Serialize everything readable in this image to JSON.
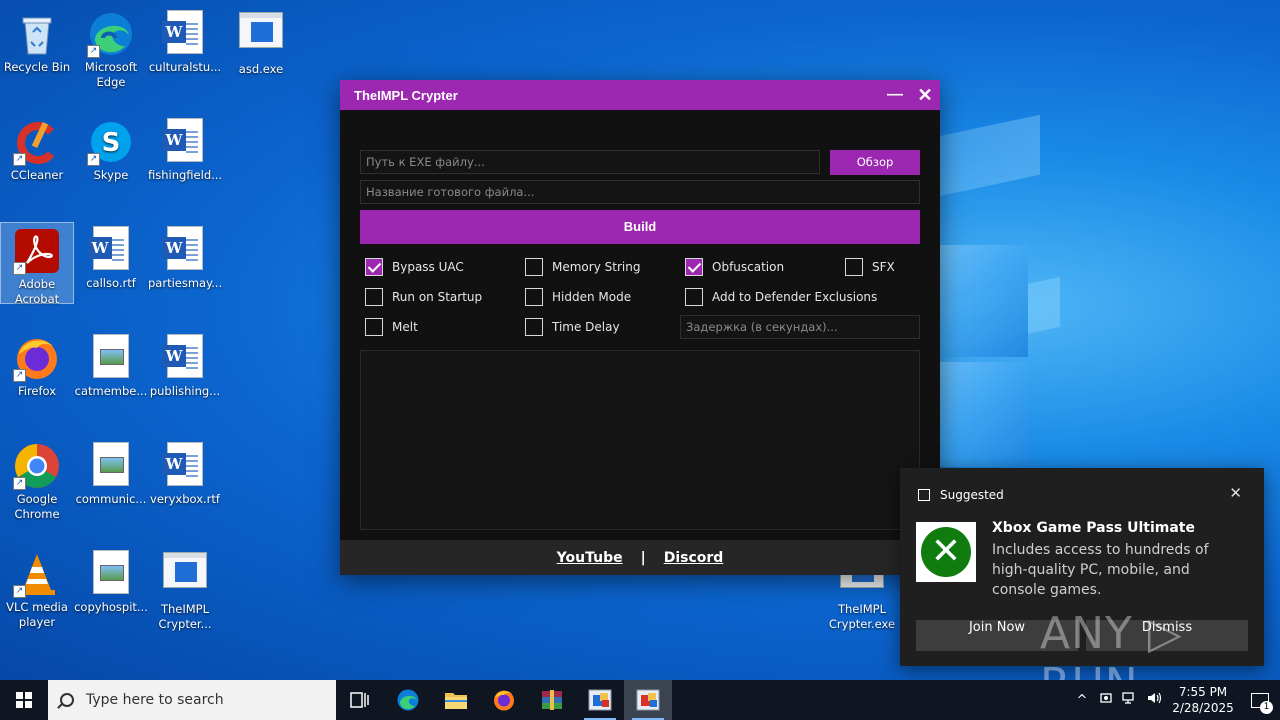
{
  "desktop": {
    "icons": [
      {
        "label": "Recycle Bin"
      },
      {
        "label": "Microsoft Edge"
      },
      {
        "label": "culturalstu..."
      },
      {
        "label": "asd.exe"
      },
      {
        "label": "CCleaner"
      },
      {
        "label": "Skype"
      },
      {
        "label": "fishingfield..."
      },
      {
        "label": "Adobe Acrobat"
      },
      {
        "label": "callso.rtf"
      },
      {
        "label": "partiesmay..."
      },
      {
        "label": "Firefox"
      },
      {
        "label": "catmembe..."
      },
      {
        "label": "publishing..."
      },
      {
        "label": "Google Chrome"
      },
      {
        "label": "communic..."
      },
      {
        "label": "veryxbox.rtf"
      },
      {
        "label": "VLC media player"
      },
      {
        "label": "copyhospit..."
      },
      {
        "label": "TheIMPL Crypter..."
      },
      {
        "label": "TheIMPL Crypter.exe"
      }
    ]
  },
  "app": {
    "title": "TheIMPL Crypter",
    "minimize_glyph": "—",
    "close_glyph": "✕",
    "exe_path_placeholder": "Путь к EXE файлу...",
    "browse_label": "Обзор",
    "output_name_placeholder": "Название готового файла...",
    "build_label": "Build",
    "options": [
      {
        "label": "Bypass UAC",
        "checked": true
      },
      {
        "label": "Memory String",
        "checked": false
      },
      {
        "label": "Obfuscation",
        "checked": true
      },
      {
        "label": "SFX",
        "checked": false
      },
      {
        "label": "Run on Startup",
        "checked": false
      },
      {
        "label": "Hidden Mode",
        "checked": false
      },
      {
        "label": "Add to Defender Exclusions",
        "checked": false
      },
      {
        "label": "Melt",
        "checked": false
      },
      {
        "label": "Time Delay",
        "checked": false
      }
    ],
    "delay_placeholder": "Задержка (в секундах)...",
    "footer": {
      "youtube": "YouTube",
      "separator": "|",
      "discord": "Discord"
    },
    "accent_color": "#9c27b0"
  },
  "notification": {
    "header": "Suggested",
    "close_glyph": "✕",
    "title": "Xbox Game Pass Ultimate",
    "description": "Includes access to hundreds of high-quality PC, mobile, and console games.",
    "join_label": "Join Now",
    "dismiss_label": "Dismiss",
    "xbox_glyph": "✕"
  },
  "watermark": "ANY ▷ RUN",
  "taskbar": {
    "search_placeholder": "Type here to search",
    "time": "7:55 PM",
    "date": "2/28/2025",
    "notification_count": "1",
    "tray_chevron": "^"
  }
}
